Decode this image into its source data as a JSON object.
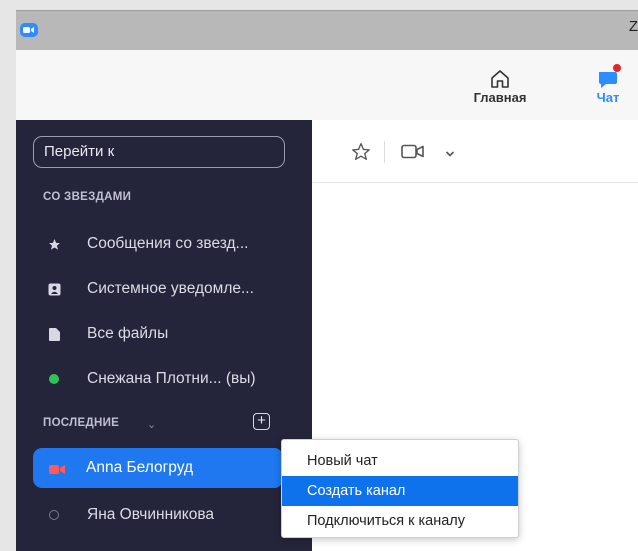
{
  "window": {
    "title_fragment": "Z"
  },
  "topnav": {
    "home_label": "Главная",
    "chat_label": "Чат"
  },
  "sidebar": {
    "search_placeholder": "Перейти к",
    "starred_section": "СО ЗВЕЗДАМИ",
    "starred_items": [
      {
        "label": "Сообщения со звезд...",
        "icon": "star-icon"
      },
      {
        "label": "Системное уведомле...",
        "icon": "contact-card-icon"
      },
      {
        "label": "Все файлы",
        "icon": "file-icon"
      },
      {
        "label": "Снежана Плотни... (вы)",
        "icon": "online-status-dot"
      }
    ],
    "recent_section": "ПОСЛЕДНИЕ",
    "recent_items": [
      {
        "label": "Anna Белогруд",
        "icon": "video-icon",
        "active": true
      },
      {
        "label": "Яна Овчинникова",
        "icon": "offline-status-ring"
      }
    ]
  },
  "context_menu": {
    "items": [
      {
        "label": "Новый чат"
      },
      {
        "label": "Создать канал",
        "highlighted": true
      },
      {
        "label": "Подключиться к каналу"
      }
    ]
  },
  "colors": {
    "accent": "#2D8CFF",
    "sidebar_bg": "#24243b",
    "active_item": "#1F78F0",
    "menu_highlight": "#0E72ED",
    "online": "#2FC45A",
    "notification": "#E02828"
  }
}
